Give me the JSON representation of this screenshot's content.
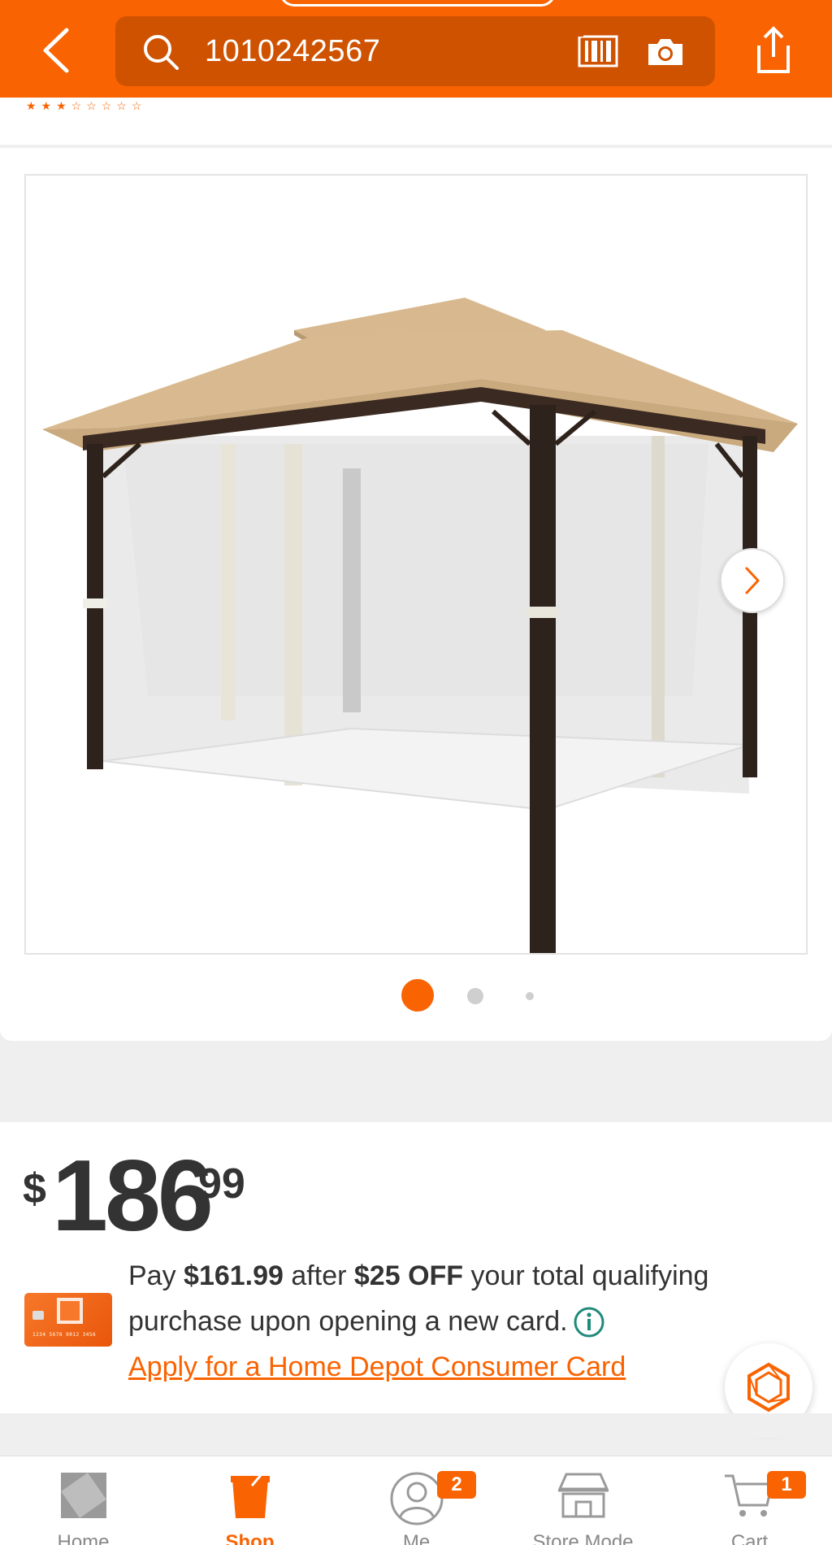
{
  "header": {
    "search_value": "1010242567",
    "icons": {
      "back": "chevron-left-icon",
      "search": "search-icon",
      "barcode": "barcode-scan-icon",
      "camera": "camera-icon",
      "share": "share-icon"
    }
  },
  "gallery": {
    "image_description": "",
    "dots_total": 3,
    "active_dot": 1,
    "next_icon": "chevron-right-icon"
  },
  "price": {
    "currency": "$",
    "dollars": "186",
    "cents": "99"
  },
  "promo": {
    "pay_prefix": "Pay ",
    "pay_amount": "$161.99",
    "after_text": " after ",
    "discount": "$25 OFF",
    "line1_suffix": " your total qualifying",
    "line2": "purchase upon opening a new card.",
    "apply_link": "Apply for a Home Depot Consumer Card",
    "card_number": "1234 5678 9012 3456"
  },
  "nav": {
    "items": [
      {
        "label": "Home",
        "icon": "home-depot-logo-icon"
      },
      {
        "label": "Shop",
        "icon": "shop-bucket-icon"
      },
      {
        "label": "Me",
        "icon": "user-icon",
        "badge": "2"
      },
      {
        "label": "Store Mode",
        "icon": "store-icon"
      },
      {
        "label": "Cart",
        "icon": "cart-icon",
        "badge": "1"
      }
    ],
    "active": "Shop"
  },
  "colors": {
    "brand_orange": "#f96302",
    "search_bg": "#cf5200",
    "text_dark": "#333333"
  }
}
